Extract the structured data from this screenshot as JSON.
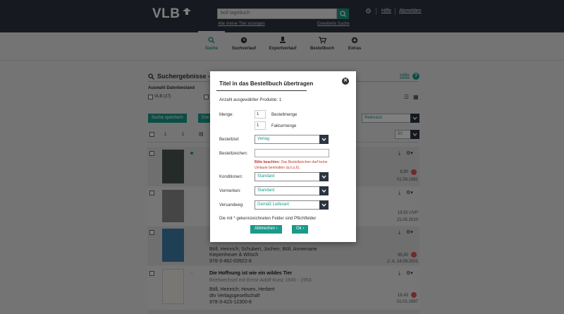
{
  "header": {
    "logo": "VLB",
    "search_value": "boll tagebuch",
    "all_titles_link": "Alle meine Titel anzeigen",
    "advanced_search_link": "Erweiterte Suche",
    "help_link": "Hilfe",
    "logout_link": "Abmelden"
  },
  "tabs": [
    {
      "label": "Suche",
      "icon": "search-icon"
    },
    {
      "label": "Suchverlauf",
      "icon": "clock-icon"
    },
    {
      "label": "Exportverlauf",
      "icon": "export-icon"
    },
    {
      "label": "Bestellbuch",
      "icon": "cart-icon"
    },
    {
      "label": "Extras",
      "icon": "plus-icon"
    }
  ],
  "results": {
    "title": "Suchergebnisse - 27 T",
    "help": "Hilfe",
    "dataset_label": "Auswahl Datenbestand",
    "vlb_count": "VLB (27)",
    "save_search_btn": "Suche speichern",
    "other_btn_partial": "Erw",
    "sort_value": "Relevanz",
    "per_page": "50",
    "rows": [
      {
        "price": "8,90",
        "date": "01.09.1981"
      },
      {
        "price": "19,50 UVP",
        "date": "21.05.2010"
      },
      {
        "authors": "Böll, Heinrich; Schubert, Jochen; Böll, Annemarie",
        "publisher": "Kiepenheuer & Witsch",
        "isbn": "978-3-462-03922-8",
        "price": "95,90",
        "date": "2. A. 24.09.2001"
      },
      {
        "title": "Die Hoffnung ist wie ein wildes Tier",
        "subtitle": "Briefwechsel mit Ernst-Adolf Kunz 1945 - 1953",
        "authors": "Böll, Heinrich; Hoven, Herbert",
        "publisher": "dtv Verlagsgesellschaft",
        "isbn": "978-3-423-12300-8",
        "price": "18,43",
        "date": "01.01.1997"
      }
    ]
  },
  "modal": {
    "title": "Titel in das Bestellbuch übertragen",
    "count_text": "Anzahl ausgewählter Produkte: 1",
    "menge_label": "Menge:",
    "bestellmenge_value": "1",
    "bestellmenge_label": "Bestellmenge",
    "fakturmenge_value": "1",
    "fakturmenge_label": "Fakturmenge",
    "bestellziel_label": "Bestellziel:",
    "bestellziel_value": "Verlag",
    "bestellzeichen_label": "Bestellzeichen:",
    "warning_bold": "Bitte beachten:",
    "warning_text": " Das Bestellzeichen darf keine Umlaute beinhalten (ä,ö,ü,ß).",
    "konditionen_label": "Konditionen:",
    "konditionen_value": "Standard",
    "vormerken_label": "Vormerken:",
    "vormerken_value": "Standard",
    "versandweg_label": "Versandweg:",
    "versandweg_value": "Gemäß Lieferant",
    "required_note": "Die mit * gekennzeichneten Felder sind Pflichtfelder",
    "cancel_btn": "Abbrechen",
    "ok_btn": "Ok"
  }
}
